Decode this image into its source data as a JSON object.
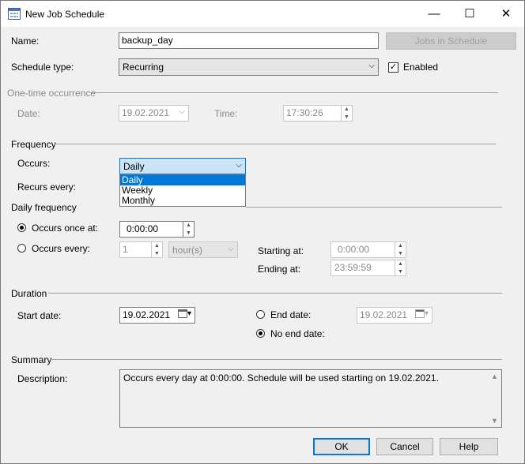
{
  "window": {
    "title": "New Job Schedule",
    "minimize": "—",
    "maximize": "☐",
    "close": "✕"
  },
  "name": {
    "label": "Name:",
    "value": "backup_day"
  },
  "jobs_in_schedule_button": "Jobs in Schedule",
  "schedule_type": {
    "label": "Schedule type:",
    "value": "Recurring"
  },
  "enabled": {
    "label": "Enabled",
    "checked": true
  },
  "one_time": {
    "group": "One-time occurrence",
    "date_label": "Date:",
    "date_value": "19.02.2021",
    "time_label": "Time:",
    "time_value": "17:30:26"
  },
  "frequency": {
    "group": "Frequency",
    "occurs_label": "Occurs:",
    "occurs_value": "Daily",
    "recurs_label": "Recurs every:",
    "options": [
      "Daily",
      "Weekly",
      "Monthly"
    ]
  },
  "daily_frequency": {
    "group": "Daily frequency",
    "once_label": "Occurs once at:",
    "once_value": "0:00:00",
    "every_label": "Occurs every:",
    "every_value": "1",
    "every_unit": "hour(s)",
    "starting_label": "Starting at:",
    "starting_value": "0:00:00",
    "ending_label": "Ending at:",
    "ending_value": "23:59:59"
  },
  "duration": {
    "group": "Duration",
    "start_label": "Start date:",
    "start_value": "19.02.2021",
    "end_label": "End date:",
    "end_value": "19.02.2021",
    "no_end_label": "No end date:"
  },
  "summary": {
    "group": "Summary",
    "description_label": "Description:",
    "description": "Occurs every day at 0:00:00. Schedule will be used starting on 19.02.2021."
  },
  "buttons": {
    "ok": "OK",
    "cancel": "Cancel",
    "help": "Help"
  }
}
